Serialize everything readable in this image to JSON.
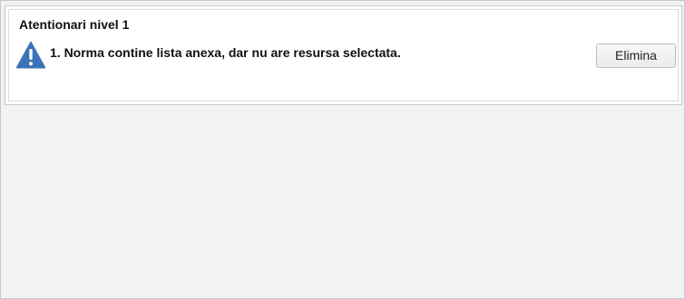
{
  "panel": {
    "title": "Atentionari nivel 1"
  },
  "warnings": [
    {
      "icon": "warning-icon",
      "text": "1. Norma contine lista anexa, dar nu are resursa selectata.",
      "action_label": "Elimina"
    }
  ],
  "colors": {
    "warning_icon": "#3a73b8",
    "background": "#f2f2f2",
    "panel": "#ffffff"
  }
}
